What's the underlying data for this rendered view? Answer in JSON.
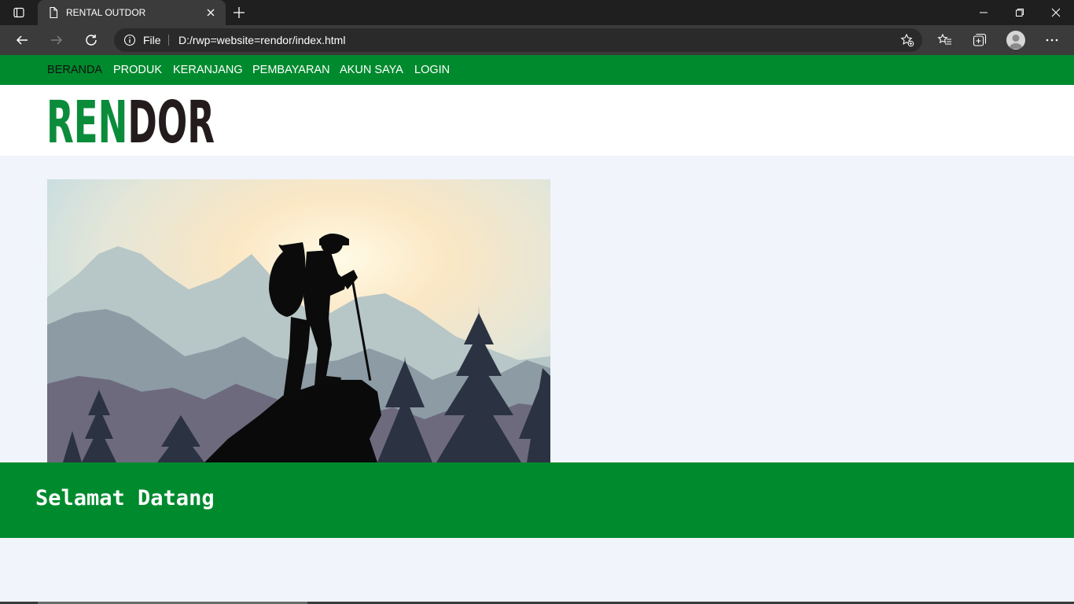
{
  "browser": {
    "tab_title": "RENTAL OUTDOR",
    "address_scheme": "File",
    "url": "D:/rwp=website=rendor/index.html"
  },
  "site": {
    "menu": [
      {
        "label": "BERANDA",
        "active": true
      },
      {
        "label": "PRODUK",
        "active": false
      },
      {
        "label": "KERANJANG",
        "active": false
      },
      {
        "label": "PEMBAYARAN",
        "active": false
      },
      {
        "label": "AKUN SAYA",
        "active": false
      },
      {
        "label": "LOGIN",
        "active": false
      }
    ],
    "logo": {
      "part1": "REN",
      "part2": "DOR",
      "color1": "#0b8c3a",
      "color2": "#241c1c"
    },
    "welcome": "Selamat Datang"
  },
  "colors": {
    "brand_green": "#008a2e",
    "page_bg": "#f1f4fb"
  }
}
